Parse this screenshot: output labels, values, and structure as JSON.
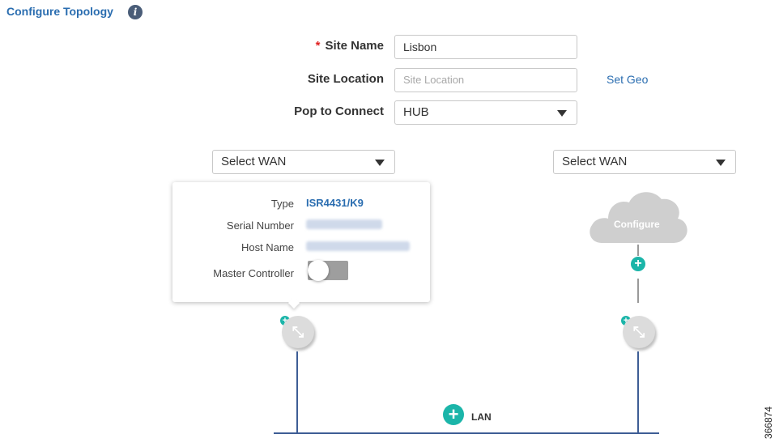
{
  "header": {
    "title": "Configure Topology",
    "info_icon": "i"
  },
  "form": {
    "site_name": {
      "label": "Site Name",
      "required_mark": "*",
      "value": "Lisbon"
    },
    "site_location": {
      "label": "Site Location",
      "placeholder": "Site Location",
      "link": "Set Geo"
    },
    "pop_to_connect": {
      "label": "Pop to Connect",
      "value": "HUB"
    }
  },
  "wan_left": {
    "value": "Select WAN"
  },
  "wan_right": {
    "value": "Select WAN"
  },
  "device_popup": {
    "type_label": "Type",
    "type_value": "ISR4431/K9",
    "serial_label": "Serial Number",
    "host_label": "Host Name",
    "master_label": "Master Controller"
  },
  "cloud": {
    "label": "Configure"
  },
  "lan": {
    "label": "LAN"
  },
  "figure_id": "366874",
  "colors": {
    "accent": "#2a6db0",
    "teal": "#1bb5a9",
    "line": "#3e5d95",
    "required": "#e02020"
  },
  "icons": [
    "info-icon",
    "caret-down-icon",
    "router-icon",
    "add-icon",
    "cloud-icon",
    "toggle-switch"
  ]
}
